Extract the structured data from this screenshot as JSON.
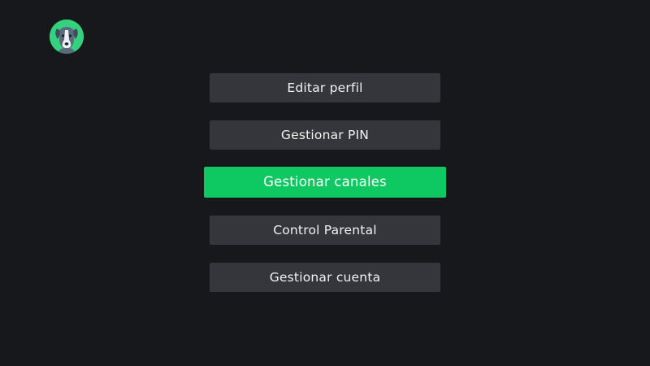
{
  "profile": {
    "avatar_icon": "dog-avatar-icon",
    "avatar_color": "#34d17e"
  },
  "menu": {
    "focused_index": 2,
    "accent_color": "#0ec862",
    "items": [
      {
        "label": "Editar perfil"
      },
      {
        "label": "Gestionar PIN"
      },
      {
        "label": "Gestionar canales"
      },
      {
        "label": "Control Parental"
      },
      {
        "label": "Gestionar cuenta"
      }
    ]
  }
}
